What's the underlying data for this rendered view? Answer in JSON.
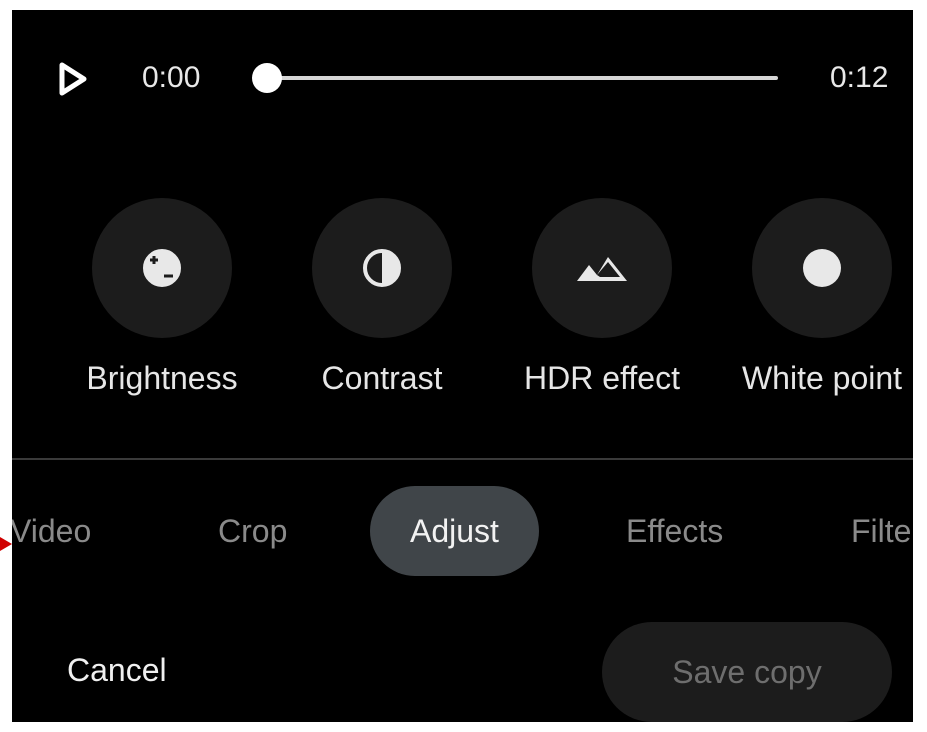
{
  "player": {
    "current_time": "0:00",
    "duration": "0:12",
    "progress": 0
  },
  "tools": [
    {
      "label": "Brightness",
      "icon": "brightness-icon"
    },
    {
      "label": "Contrast",
      "icon": "contrast-icon"
    },
    {
      "label": "HDR effect",
      "icon": "hdr-mountain-icon"
    },
    {
      "label": "White point",
      "icon": "white-point-icon"
    }
  ],
  "tabs": [
    {
      "label": "Video",
      "active": false
    },
    {
      "label": "Crop",
      "active": false
    },
    {
      "label": "Adjust",
      "active": true
    },
    {
      "label": "Effects",
      "active": false
    },
    {
      "label": "Filters",
      "active": false
    }
  ],
  "actions": {
    "cancel_label": "Cancel",
    "save_label": "Save copy"
  },
  "colors": {
    "background": "#000000",
    "tool_circle": "#1c1c1c",
    "active_tab": "#404549",
    "marker": "#d00000"
  }
}
